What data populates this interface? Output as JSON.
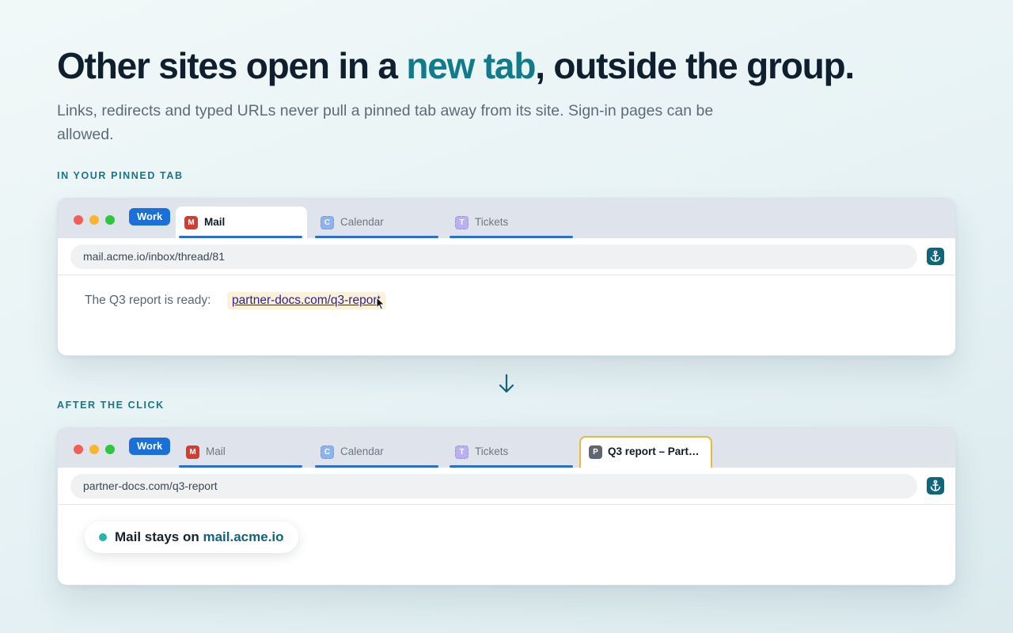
{
  "headline": {
    "before": "Other sites open in a ",
    "accent": "new tab",
    "after": ", outside the group."
  },
  "subhead": "Links, redirects and typed URLs never pull a pinned tab away from its site. Sign-in pages can be allowed.",
  "sections": {
    "before_label": "IN YOUR PINNED TAB",
    "after_label": "AFTER THE CLICK"
  },
  "before": {
    "group_label": "Work",
    "tabs": [
      {
        "favicon": "M",
        "label": "Mail"
      },
      {
        "favicon": "C",
        "label": "Calendar"
      },
      {
        "favicon": "T",
        "label": "Tickets"
      }
    ],
    "url": "mail.acme.io/inbox/thread/81",
    "message": "The Q3 report is ready:",
    "link": "partner-docs.com/q3-report"
  },
  "after": {
    "group_label": "Work",
    "tabs": [
      {
        "favicon": "M",
        "label": "Mail"
      },
      {
        "favicon": "C",
        "label": "Calendar"
      },
      {
        "favicon": "T",
        "label": "Tickets"
      }
    ],
    "new_tab": {
      "favicon": "P",
      "label": "Q3 report – Part…"
    },
    "url": "partner-docs.com/q3-report",
    "status_prefix": "Mail stays on ",
    "status_host": "mail.acme.io"
  },
  "colors": {
    "accent": "#117a8b",
    "group_chip": "#1a6fd8",
    "new_tab_border": "#f2b53a",
    "status_dot": "#27b3a8"
  },
  "icons": {
    "pin_button": "anchor-icon",
    "transition": "arrow-down-icon",
    "pointer": "mouse-cursor-icon"
  }
}
